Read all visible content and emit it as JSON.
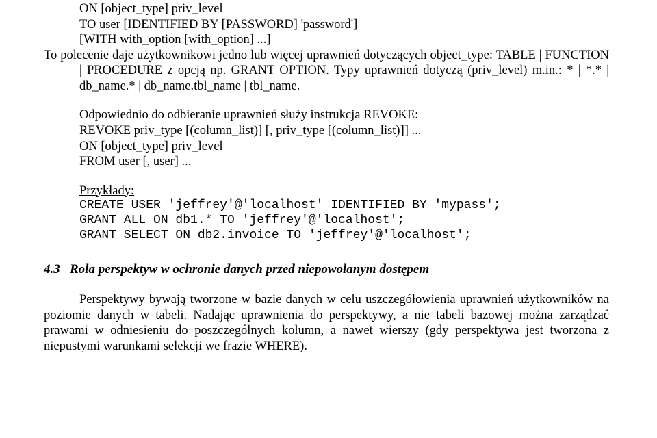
{
  "syntax_grant": {
    "l1": "ON [object_type] priv_level",
    "l2": "TO user [IDENTIFIED BY [PASSWORD] 'password']",
    "l3": "[WITH with_option [with_option] ...]"
  },
  "desc1": "To polecenie daje użytkownikowi jedno lub więcej uprawnień dotyczących object_type: TABLE | FUNCTION | PROCEDURE z opcją np. GRANT OPTION. Typy uprawnień dotyczą (priv_level) m.in.: * | *.* | db_name.* | db_name.tbl_name | tbl_name.",
  "revoke_intro": "Odpowiednio do odbieranie uprawnień służy instrukcja REVOKE:",
  "syntax_revoke": {
    "l1": "REVOKE priv_type [(column_list)] [, priv_type [(column_list)]] ...",
    "l2": "ON [object_type] priv_level",
    "l3": "FROM user [, user] ..."
  },
  "examples_label": "Przykłady:",
  "examples": {
    "l1": "CREATE USER 'jeffrey'@'localhost' IDENTIFIED BY 'mypass';",
    "l2": "GRANT ALL ON db1.* TO 'jeffrey'@'localhost';",
    "l3": "GRANT SELECT ON db2.invoice TO 'jeffrey'@'localhost';"
  },
  "heading": {
    "num": "4.3",
    "text": "Rola perspektyw w ochronie danych przed niepowołanym dostępem"
  },
  "body_para": "Perspektywy bywają tworzone w bazie danych w celu uszczegółowienia uprawnień użytkowników na poziomie danych w tabeli. Nadając uprawnienia do perspektywy, a nie tabeli bazowej można zarządzać prawami w odniesieniu do poszczególnych kolumn, a nawet wierszy (gdy perspektywa jest tworzona z niepustymi warunkami selekcji we frazie WHERE)."
}
